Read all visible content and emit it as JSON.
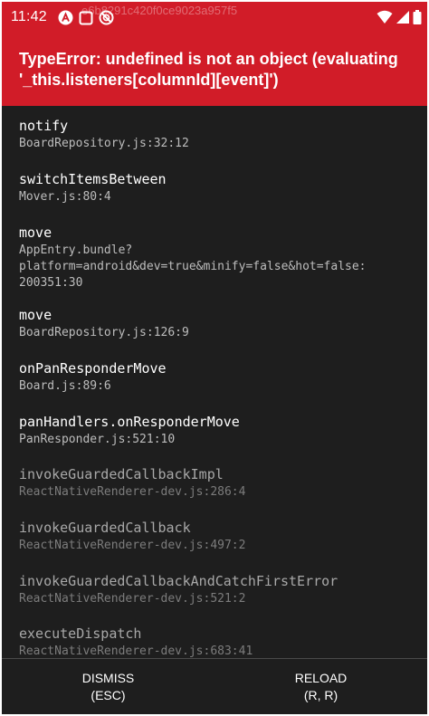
{
  "status_bar": {
    "time": "11:42",
    "overlay_text": "e6b8291c420f0ce9023a957f5",
    "icons": [
      "app-a-icon",
      "notification-box-icon",
      "no-disturb-icon",
      "wifi-icon",
      "signal-icon",
      "battery-icon"
    ]
  },
  "error": {
    "message": "TypeError: undefined is not an object (evaluating '_this.listeners[columnId][event]')"
  },
  "stack": [
    {
      "method": "notify",
      "location": "BoardRepository.js:32:12",
      "dim": false
    },
    {
      "method": "switchItemsBetween",
      "location": "Mover.js:80:4",
      "dim": false
    },
    {
      "method": "move",
      "location": "AppEntry.bundle?\nplatform=android&dev=true&minify=false&hot=false:\n200351:30",
      "dim": false
    },
    {
      "method": "move",
      "location": "BoardRepository.js:126:9",
      "dim": false
    },
    {
      "method": "onPanResponderMove",
      "location": "Board.js:89:6",
      "dim": false
    },
    {
      "method": "panHandlers.onResponderMove",
      "location": "PanResponder.js:521:10",
      "dim": false
    },
    {
      "method": "invokeGuardedCallbackImpl",
      "location": "ReactNativeRenderer-dev.js:286:4",
      "dim": true
    },
    {
      "method": "invokeGuardedCallback",
      "location": "ReactNativeRenderer-dev.js:497:2",
      "dim": true
    },
    {
      "method": "invokeGuardedCallbackAndCatchFirstError",
      "location": "ReactNativeRenderer-dev.js:521:2",
      "dim": true
    },
    {
      "method": "executeDispatch",
      "location": "ReactNativeRenderer-dev.js:683:41",
      "dim": true
    }
  ],
  "footer": {
    "dismiss_label": "DISMISS",
    "dismiss_shortcut": "(ESC)",
    "reload_label": "RELOAD",
    "reload_shortcut": "(R, R)"
  },
  "colors": {
    "header_red": "#d11c28",
    "background": "#1e1e1e",
    "text_primary": "#ffffff",
    "text_secondary": "#bdbdbd",
    "text_dim": "#7c7c7c"
  }
}
